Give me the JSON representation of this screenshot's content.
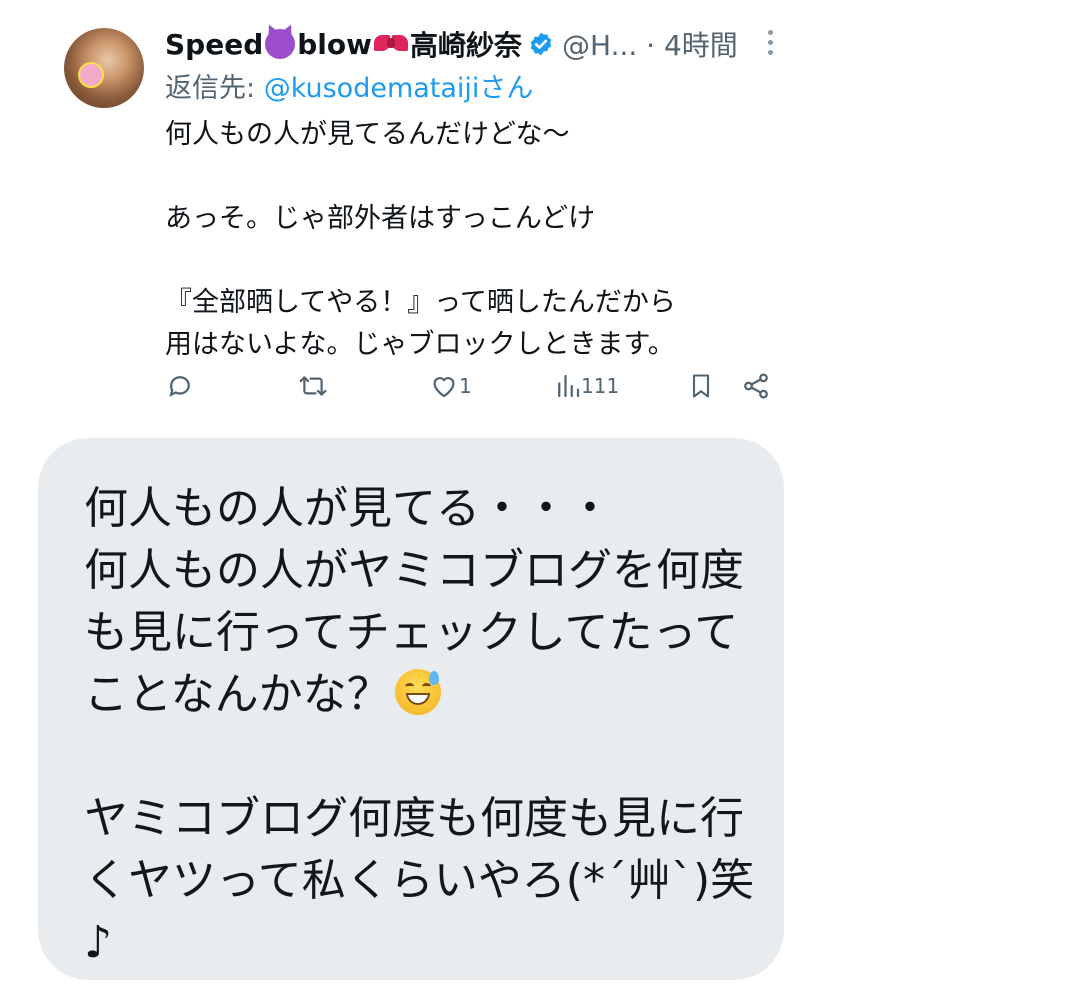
{
  "tweet": {
    "display_name": {
      "part1": "Speed",
      "part2": "blow",
      "part3": "高崎紗奈"
    },
    "name_emojis": [
      "smiling-imp-emoji",
      "ribbon-emoji"
    ],
    "verified": true,
    "handle_time": "@H... · 4時間",
    "reply_prefix": "返信先: ",
    "reply_mention": "@kusodemataijiさん",
    "body": "何人もの人が見てるんだけどな〜\n\nあっそ。じゃ部外者はすっこんどけ\n\n『全部晒してやる！』って晒したんだから\n用はないよな。じゃブロックしときます。",
    "actions": {
      "reply_count": "",
      "retweet_count": "",
      "like_count": "1",
      "view_count": "111"
    },
    "colors": {
      "link": "#1d9bf0",
      "secondary_text": "#536471",
      "verified": "#1d9bf0"
    }
  },
  "reply_bubble": {
    "text_part1": "何人もの人が見てる・・・\n何人もの人がヤミコブログを何度\nも見に行ってチェックしてたって\nことなんかな？",
    "emoji": "grinning-face-with-sweat-emoji",
    "text_part2": "\n\nヤミコブログ何度も何度も見に行\nくヤツって私くらいやろ(*´艸`)笑\n♪",
    "background": "#e9ecef"
  }
}
